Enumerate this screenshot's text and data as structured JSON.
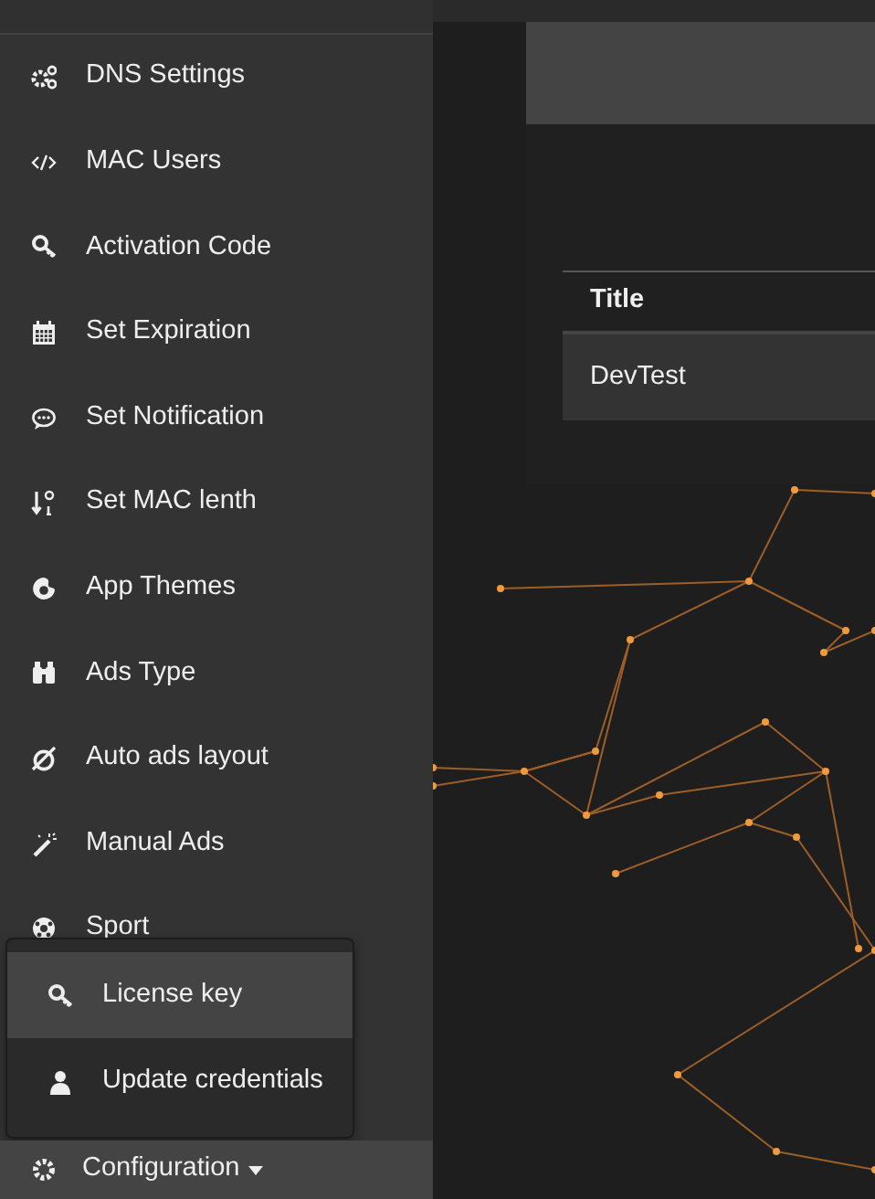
{
  "sidebar": {
    "items": [
      {
        "label": "DNS Settings"
      },
      {
        "label": "MAC Users"
      },
      {
        "label": "Activation Code"
      },
      {
        "label": "Set Expiration"
      },
      {
        "label": "Set Notification"
      },
      {
        "label": "Set MAC lenth"
      },
      {
        "label": "App Themes"
      },
      {
        "label": "Ads Type"
      },
      {
        "label": "Auto ads layout"
      },
      {
        "label": "Manual Ads"
      },
      {
        "label": "Sport"
      }
    ],
    "configuration": {
      "label": "Configuration",
      "expanded": true,
      "menu": [
        {
          "label": "License key",
          "selected": true
        },
        {
          "label": "Update credentials",
          "selected": false
        }
      ]
    }
  },
  "table": {
    "columns": [
      "Title"
    ],
    "rows": [
      [
        "DevTest"
      ]
    ]
  }
}
